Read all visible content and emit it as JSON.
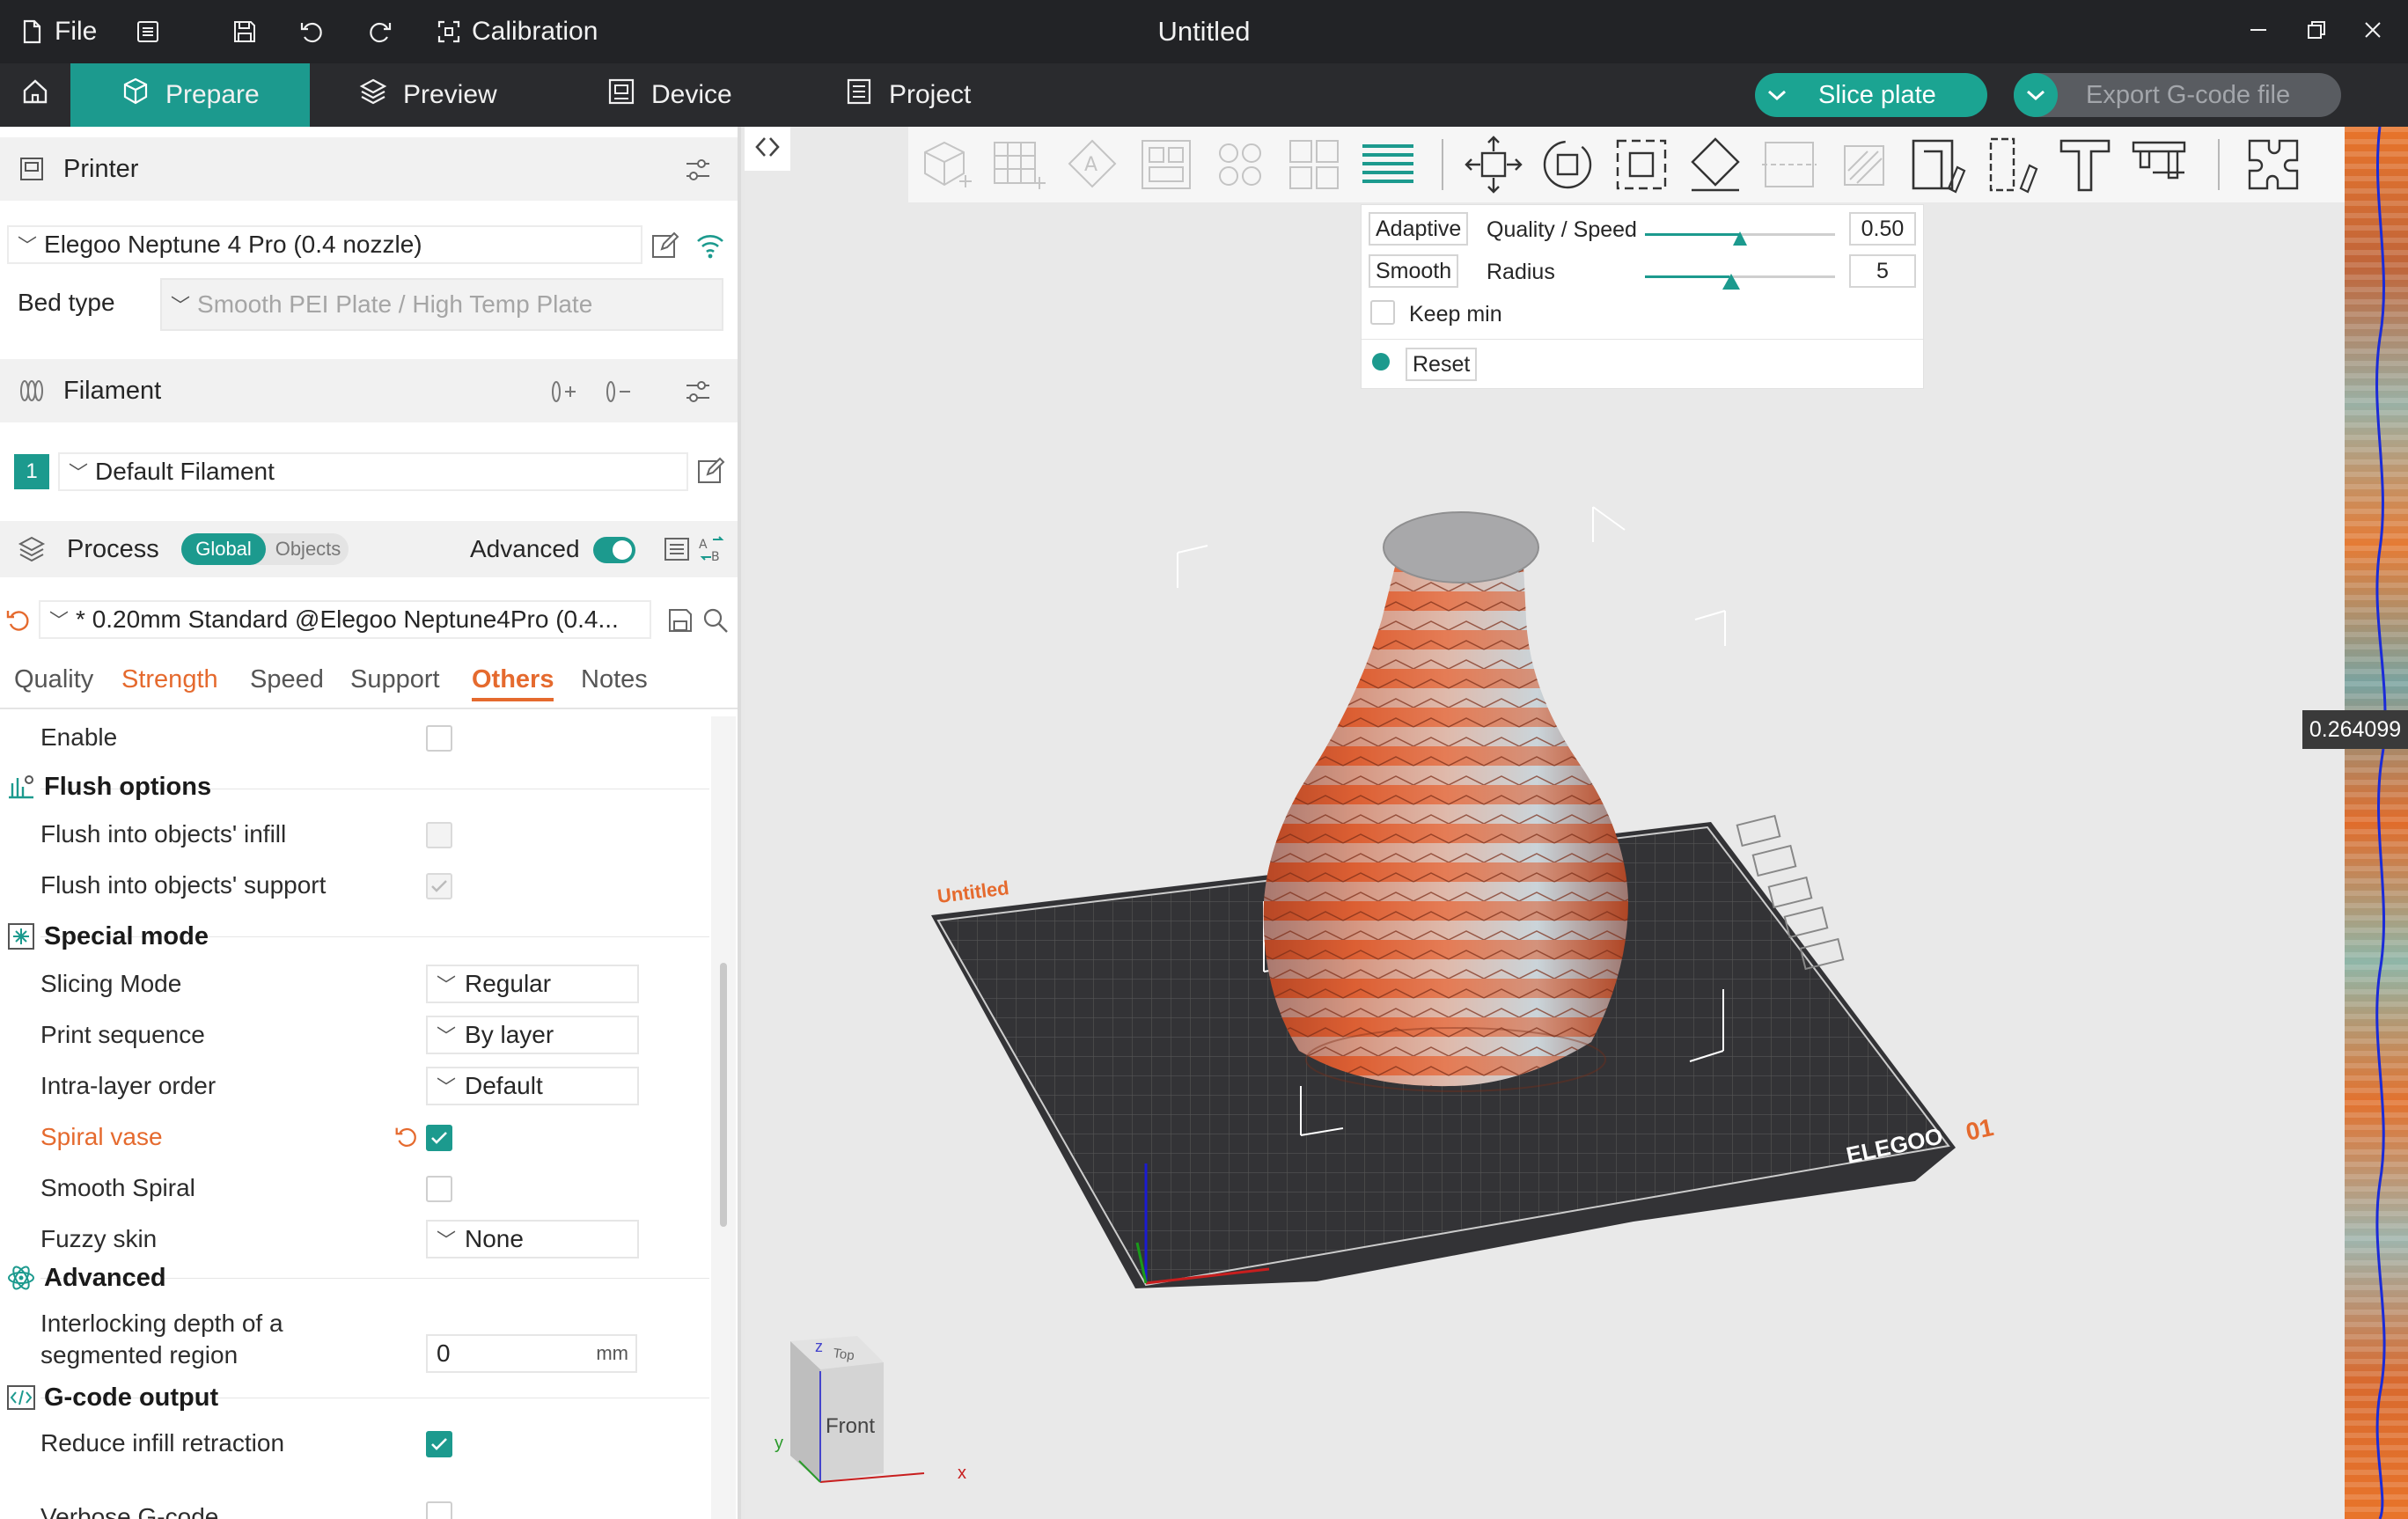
{
  "window": {
    "file_label": "File",
    "calibration_label": "Calibration",
    "title": "Untitled"
  },
  "nav": {
    "tabs": [
      {
        "label": "Prepare"
      },
      {
        "label": "Preview"
      },
      {
        "label": "Device"
      },
      {
        "label": "Project"
      }
    ],
    "slice_label": "Slice plate",
    "export_label": "Export G-code file"
  },
  "printer": {
    "header": "Printer",
    "name": "Elegoo Neptune 4 Pro (0.4 nozzle)",
    "bed_type_label": "Bed type",
    "bed_type_value": "Smooth PEI Plate / High Temp Plate"
  },
  "filament": {
    "header": "Filament",
    "slot_number": "1",
    "name": "Default Filament"
  },
  "process": {
    "header": "Process",
    "toggle_global": "Global",
    "toggle_objects": "Objects",
    "advanced_label": "Advanced",
    "profile": "* 0.20mm Standard @Elegoo Neptune4Pro (0.4...",
    "tabs": [
      "Quality",
      "Strength",
      "Speed",
      "Support",
      "Others",
      "Notes"
    ],
    "active_tab": "Others"
  },
  "options": {
    "enable_label": "Enable",
    "flush_group": "Flush options",
    "flush_infill": "Flush into objects' infill",
    "flush_support": "Flush into objects' support",
    "special_group": "Special mode",
    "slicing_mode": {
      "label": "Slicing Mode",
      "value": "Regular"
    },
    "print_sequence": {
      "label": "Print sequence",
      "value": "By layer"
    },
    "intra_layer": {
      "label": "Intra-layer order",
      "value": "Default"
    },
    "spiral_vase": "Spiral vase",
    "smooth_spiral": "Smooth Spiral",
    "fuzzy_skin": {
      "label": "Fuzzy skin",
      "value": "None"
    },
    "advanced_group": "Advanced",
    "interlock_line1": "Interlocking depth of a",
    "interlock_line2": "segmented region",
    "interlock_value": "0",
    "interlock_unit": "mm",
    "gcode_group": "G-code output",
    "reduce_retraction": "Reduce infill retraction",
    "verbose_gcode": "Verbose G-code"
  },
  "adaptive": {
    "adaptive_btn": "Adaptive",
    "quality_speed_label": "Quality / Speed",
    "quality_value": "0.50",
    "quality_fraction": 0.5,
    "smooth_btn": "Smooth",
    "radius_label": "Radius",
    "radius_value": "5",
    "keep_min_label": "Keep min",
    "reset_label": "Reset"
  },
  "viewport": {
    "plate_name": "Untitled",
    "plate_number": "01",
    "brand": "ELEGOO",
    "cube_top": "Top",
    "cube_front": "Front",
    "axis_x": "x",
    "axis_y": "y",
    "axis_z": "z",
    "layer_value": "0.264099"
  },
  "colors": {
    "accent": "#1c9a8e",
    "modified": "#e56a2e",
    "titlebar": "#222326"
  }
}
